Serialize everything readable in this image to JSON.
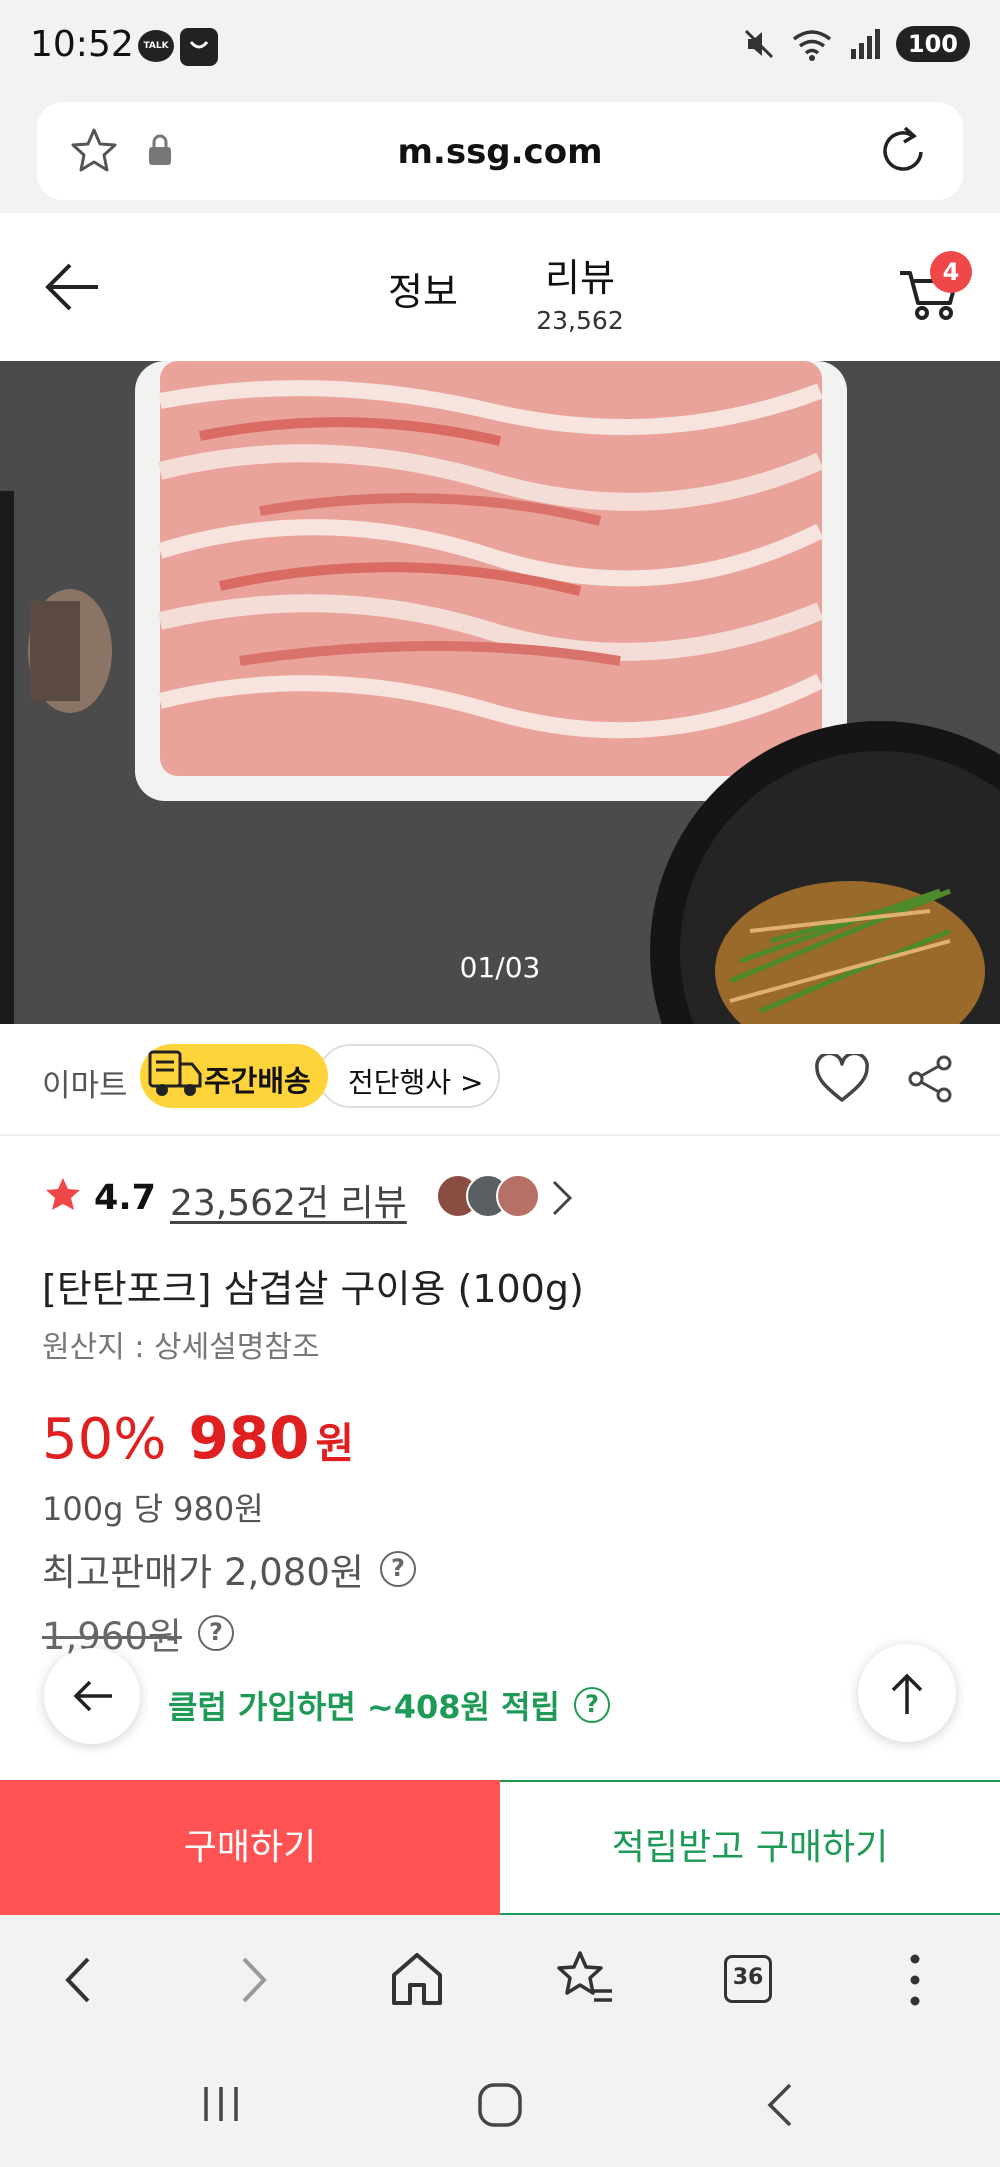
{
  "status_bar": {
    "time": "10:52",
    "talk_icon": "TALK",
    "battery": "100"
  },
  "url_bar": {
    "url": "m.ssg.com"
  },
  "header": {
    "tab_info": "정보",
    "tab_review": "리뷰",
    "review_count": "23,562",
    "cart_count": "4"
  },
  "image": {
    "counter": "01/03"
  },
  "seller": {
    "brand": "이마트",
    "weekly_delivery": "주간배송",
    "promotion": "전단행사 >"
  },
  "rating": {
    "score": "4.7",
    "reviews_link": "23,562건 리뷰"
  },
  "product": {
    "title": "[탄탄포크] 삼겹살 구이용 (100g)",
    "origin": "원산지 : 상세설명참조",
    "discount": "50%",
    "price": "980",
    "currency": "원",
    "unit_price": "100g 당 980원",
    "max_price": "최고판매가 2,080원",
    "original_price": "1,960원",
    "reward": "클럽 가입하면 ~408원 적립",
    "help_symbol": "?"
  },
  "actions": {
    "buy": "구매하기",
    "reward_buy": "적립받고 구매하기"
  },
  "browser": {
    "tabs_count": "36"
  },
  "colors": {
    "accent_red": "#e02020",
    "buy_button": "#ff5252",
    "reward_green": "#1d9a55",
    "weekly_yellow": "#ffd43b"
  }
}
